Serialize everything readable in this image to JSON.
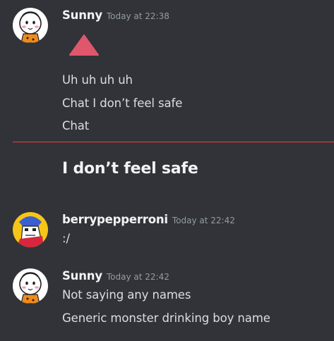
{
  "messages": [
    {
      "username": "Sunny",
      "timestamp": "Today at 22:38",
      "avatar": "sunny-avatar",
      "attachment_icon": "red-triangle-emoji",
      "lines": [
        "Uh uh uh uh",
        "Chat I don’t feel safe",
        "Chat"
      ]
    },
    {
      "big_line": "I don’t feel safe"
    },
    {
      "username": "berrypepperroni",
      "timestamp": "Today at 22:42",
      "avatar": "berrypepperroni-avatar",
      "lines": [
        ":/"
      ]
    },
    {
      "username": "Sunny",
      "timestamp": "Today at 22:42",
      "avatar": "sunny-avatar",
      "lines": [
        "Not saying any names",
        "Generic monster drinking boy name"
      ]
    }
  ],
  "colors": {
    "background": "#313338",
    "username": "#f2f3f5",
    "timestamp": "#949ba4",
    "message_text": "#dbdee1",
    "new_messages_divider": "#f23f43",
    "triangle": "#e0566d"
  }
}
